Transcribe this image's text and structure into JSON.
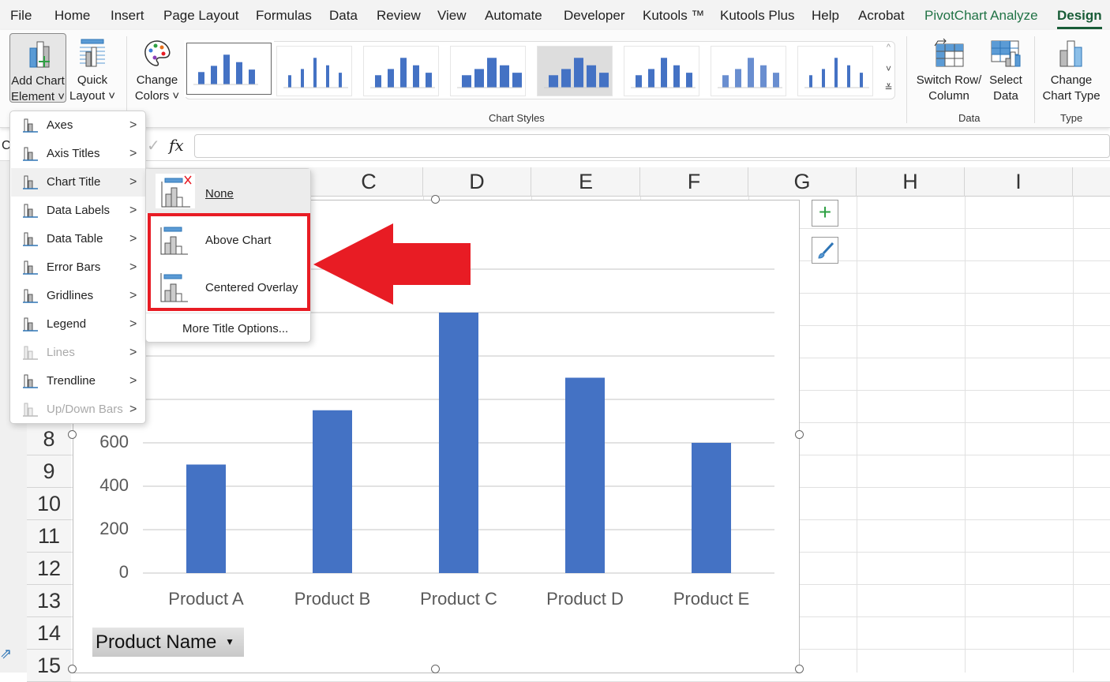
{
  "tabs": [
    {
      "label": "File"
    },
    {
      "label": "Home"
    },
    {
      "label": "Insert"
    },
    {
      "label": "Page Layout"
    },
    {
      "label": "Formulas"
    },
    {
      "label": "Data"
    },
    {
      "label": "Review"
    },
    {
      "label": "View"
    },
    {
      "label": "Automate"
    },
    {
      "label": "Developer"
    },
    {
      "label": "Kutools ™"
    },
    {
      "label": "Kutools Plus"
    },
    {
      "label": "Help"
    },
    {
      "label": "Acrobat"
    },
    {
      "label": "PivotChart Analyze"
    },
    {
      "label": "Design"
    }
  ],
  "active_tab": "Design",
  "ribbon": {
    "add_chart_element": {
      "line1": "Add Chart",
      "line2": "Element"
    },
    "quick_layout": {
      "line1": "Quick",
      "line2": "Layout"
    },
    "change_colors": {
      "line1": "Change",
      "line2": "Colors"
    },
    "chart_styles_label": "Chart Styles",
    "switch_row_col": {
      "line1": "Switch Row/",
      "line2": "Column"
    },
    "select_data": {
      "line1": "Select",
      "line2": "Data"
    },
    "data_group_label": "Data",
    "change_chart_type": {
      "line1": "Change",
      "line2": "Chart Type"
    },
    "type_group_label": "Type"
  },
  "formula_bar": {
    "name_box": "C",
    "fx": "fx",
    "value": ""
  },
  "columns": [
    "C",
    "D",
    "E",
    "F",
    "G",
    "H",
    "I"
  ],
  "rows": [
    "8",
    "9",
    "10",
    "11",
    "12",
    "13",
    "14",
    "15"
  ],
  "menu": {
    "items": [
      {
        "label": "Axes",
        "icon": "axes-icon",
        "enabled": true
      },
      {
        "label": "Axis Titles",
        "icon": "axis-titles-icon",
        "enabled": true
      },
      {
        "label": "Chart Title",
        "icon": "chart-title-icon",
        "enabled": true,
        "highlighted": true
      },
      {
        "label": "Data Labels",
        "icon": "data-labels-icon",
        "enabled": true
      },
      {
        "label": "Data Table",
        "icon": "data-table-icon",
        "enabled": true
      },
      {
        "label": "Error Bars",
        "icon": "error-bars-icon",
        "enabled": true
      },
      {
        "label": "Gridlines",
        "icon": "gridlines-icon",
        "enabled": true
      },
      {
        "label": "Legend",
        "icon": "legend-icon",
        "enabled": true
      },
      {
        "label": "Lines",
        "icon": "lines-icon",
        "enabled": false
      },
      {
        "label": "Trendline",
        "icon": "trendline-icon",
        "enabled": true
      },
      {
        "label": "Up/Down Bars",
        "icon": "up-down-bars-icon",
        "enabled": false
      }
    ]
  },
  "submenu": {
    "none": "None",
    "above_chart": "Above Chart",
    "centered_overlay": "Centered Overlay",
    "more_options": "More Title Options..."
  },
  "highlight_color": "#e81c24",
  "accent_color": "#4472c4",
  "chart_data": {
    "type": "bar",
    "categories": [
      "Product A",
      "Product B",
      "Product C",
      "Product D",
      "Product E"
    ],
    "values": [
      500,
      750,
      1200,
      900,
      600
    ],
    "yticks": [
      0,
      200,
      400,
      600,
      800,
      1000,
      1200,
      1400
    ],
    "ylim": [
      0,
      1400
    ],
    "grid": true,
    "color": "#4472c4",
    "field_button": "Product Name"
  }
}
